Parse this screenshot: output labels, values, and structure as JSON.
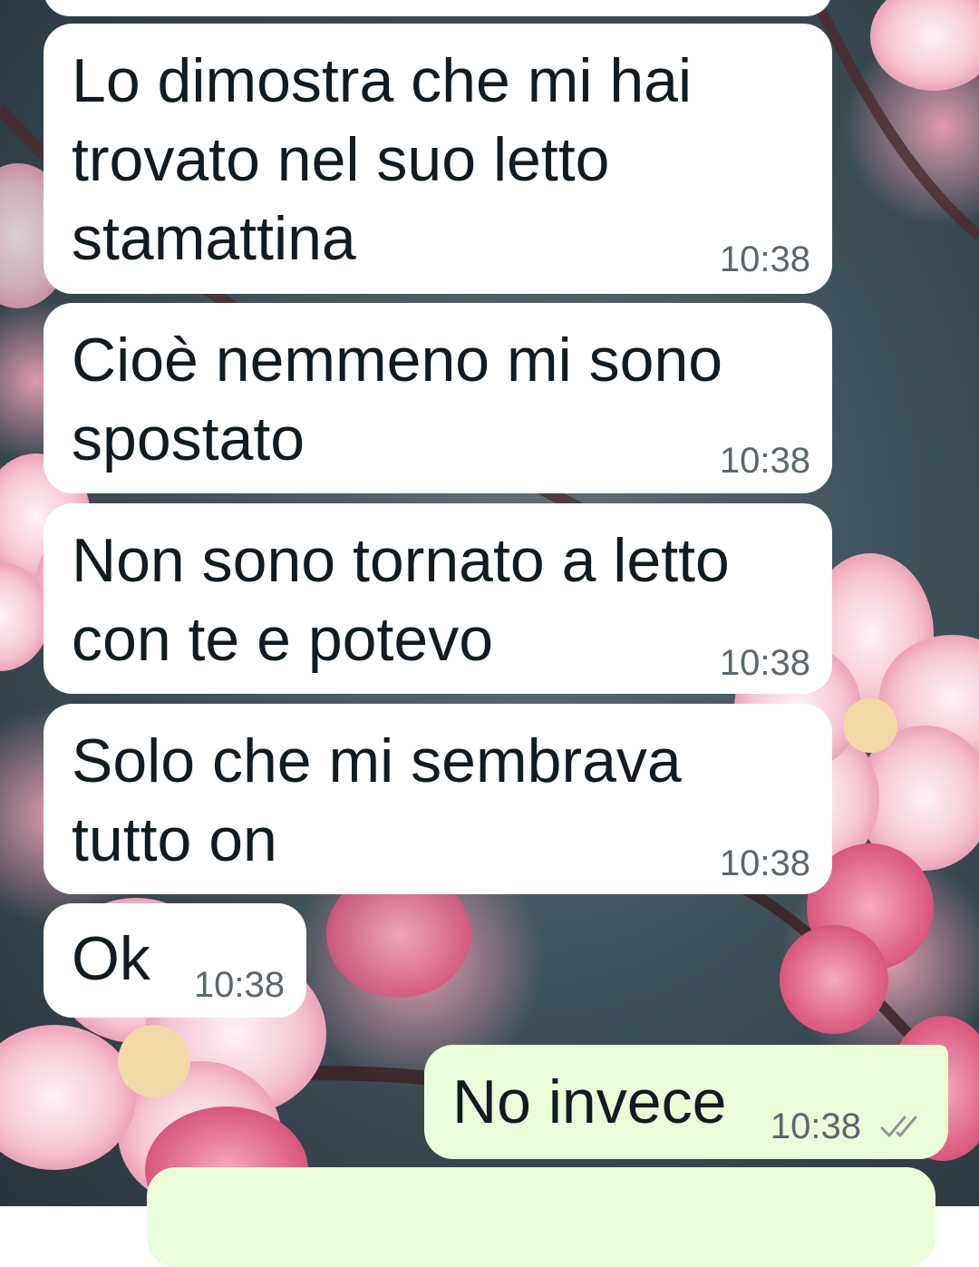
{
  "chat": {
    "messages": [
      {
        "direction": "incoming",
        "lines": [
          "Lo dimostra che mi hai",
          "trovato nel suo letto",
          "stamattina"
        ],
        "time": "10:38"
      },
      {
        "direction": "incoming",
        "lines": [
          "Cioè nemmeno mi sono",
          "spostato"
        ],
        "time": "10:38"
      },
      {
        "direction": "incoming",
        "lines": [
          "Non sono tornato a letto",
          "con te e potevo"
        ],
        "time": "10:38"
      },
      {
        "direction": "incoming",
        "lines": [
          "Solo che mi sembrava",
          "tutto on"
        ],
        "time": "10:38"
      },
      {
        "direction": "incoming",
        "lines": [
          "Ok"
        ],
        "time": "10:38"
      },
      {
        "direction": "outgoing",
        "lines": [
          "No invece"
        ],
        "time": "10:38",
        "status_icon": "double-check-icon",
        "status": "delivered"
      }
    ]
  },
  "colors": {
    "incoming_bubble": "#ffffff",
    "outgoing_bubble": "#eafdd9",
    "text": "#111b21",
    "timestamp": "#5b676d",
    "ticks": "#8a969c"
  },
  "wallpaper": {
    "description_icon": "cherry-blossom-wallpaper"
  }
}
